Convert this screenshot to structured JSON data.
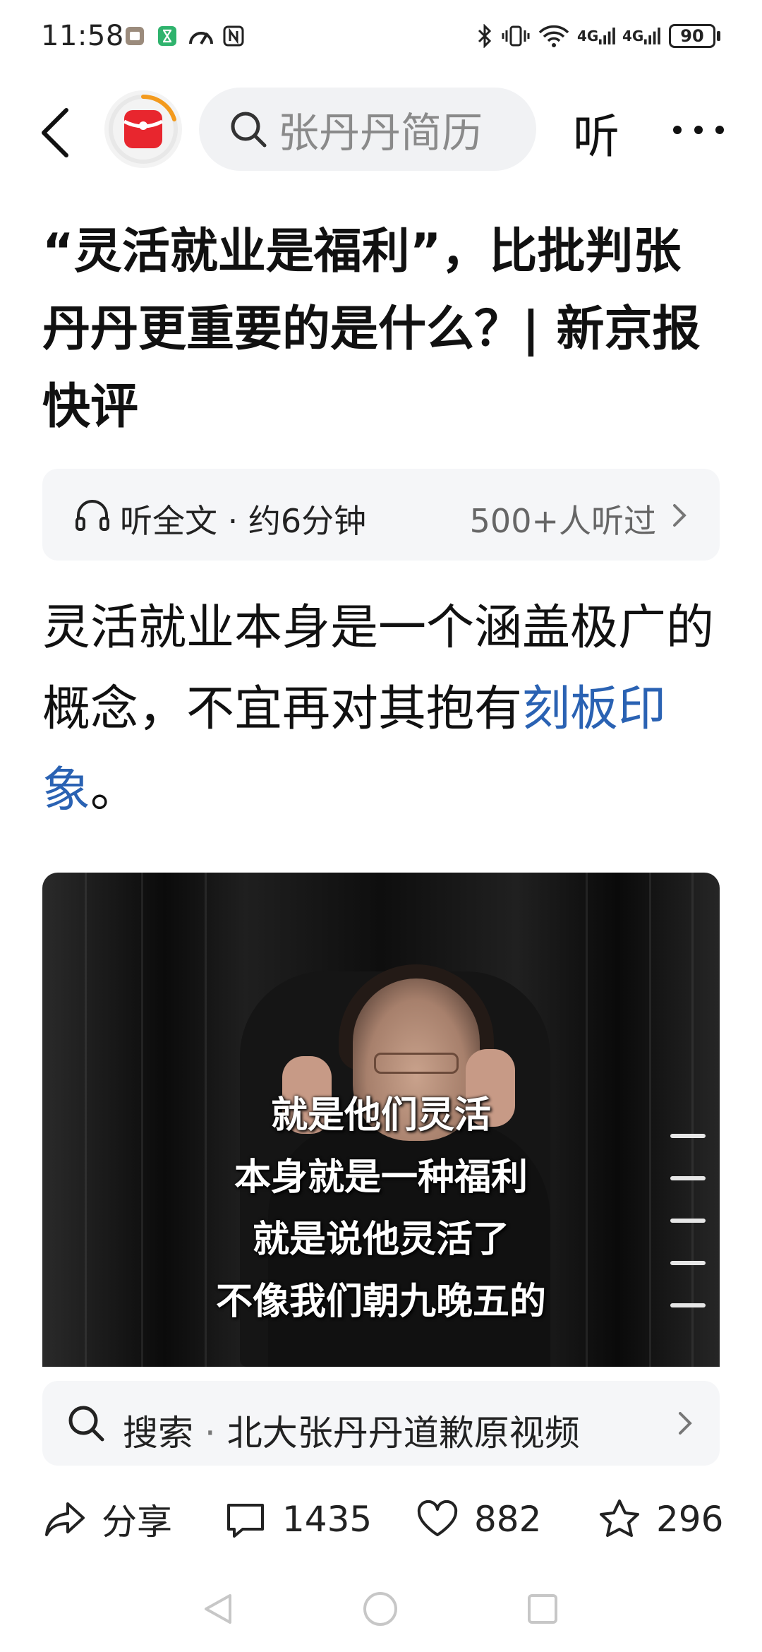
{
  "status_bar": {
    "time": "11:58",
    "network_1": "4G",
    "network_2": "4G",
    "battery": "90"
  },
  "nav": {
    "back_icon": "chevron-left-icon",
    "search_placeholder": "张丹丹简历",
    "listen_label": "听",
    "more_icon": "more-horizontal-icon"
  },
  "article": {
    "title": "“灵活就业是福利”，比批判张丹丹更重要的是什么？| 新京报快评",
    "audio": {
      "label": "听全文 · 约6分钟",
      "listeners": "500+人听过"
    },
    "lead_before": "灵活就业本身是一个涵盖极广的概念，不宜再对其抱有",
    "lead_link": "刻板印象",
    "lead_after": "。",
    "video_subtitles": [
      "就是他们灵活",
      "本身就是一种福利",
      "就是说他灵活了",
      "不像我们朝九晚五的"
    ]
  },
  "related_search": {
    "prefix": "搜索",
    "separator": "·",
    "query": "北大张丹丹道歉原视频"
  },
  "actions": {
    "share_label": "分享",
    "comments": "1435",
    "likes": "882",
    "favorites": "296"
  },
  "colors": {
    "link": "#2a62b3",
    "logo_red": "#e8262e",
    "logo_ring": "#f39a1d",
    "card_bg": "#f5f6f8"
  }
}
